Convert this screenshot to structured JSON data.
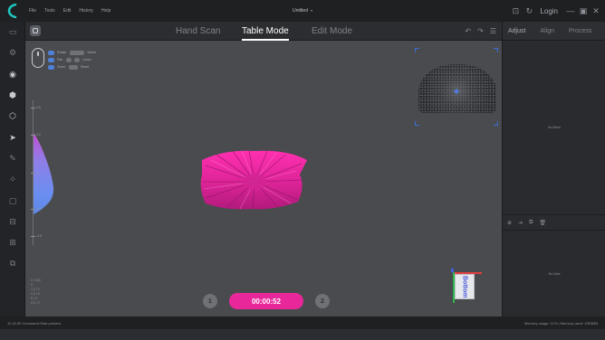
{
  "menu": {
    "items": [
      "File",
      "Tools",
      "Edit",
      "History",
      "Help"
    ],
    "title": "Untitled",
    "login": "Login"
  },
  "modes": {
    "tabs": [
      {
        "label": "Hand Scan",
        "active": false
      },
      {
        "label": "Table Mode",
        "active": true
      },
      {
        "label": "Edit Mode",
        "active": false
      }
    ]
  },
  "sidebar": {
    "tools": [
      "layers-icon",
      "scan-settings-icon",
      "camera-icon",
      "cube-solid-icon",
      "cube-outline-icon",
      "pointer-icon",
      "brush-icon",
      "grid-icon",
      "frame-icon",
      "crop-icon",
      "align-icon",
      "copy-icon"
    ]
  },
  "right_panel": {
    "tabs": [
      "Adjust",
      "Align",
      "Process"
    ],
    "top_empty": "No Mesh",
    "bottom_empty": "No Data"
  },
  "viewport": {
    "timer": "00:00:52",
    "btn_left": "1",
    "btn_right": "2",
    "gizmo_label": "Bottom",
    "scale_labels": [
      "0.5",
      "0.2",
      "0",
      "-0.2",
      "-0.5"
    ],
    "stats": [
      "0 / 100",
      "0",
      "1.2 / 0",
      "1.0 / 0",
      "0 / 0",
      "0.0 / 0"
    ],
    "legend": [
      "Rotate",
      "Pan",
      "Zoom",
      "Select",
      "Lasso",
      "Reset"
    ]
  },
  "status": {
    "left": "11:15:30 Command:Start preview",
    "right": "Memory usage: 11% | Memory used: 1953MB"
  },
  "colors": {
    "accent": "#e8289a",
    "active_tab": "#ffffff",
    "object": "#e0259a"
  }
}
